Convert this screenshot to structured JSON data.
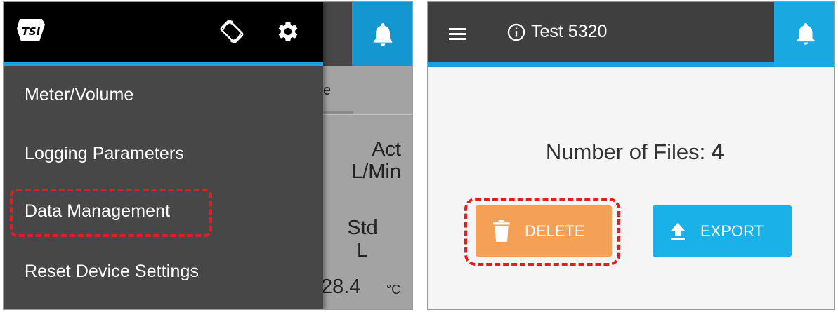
{
  "left_screen": {
    "header": {
      "logo_icon": "tsi-logo",
      "rotate_icon": "screen-rotation-icon",
      "settings_icon": "gear-icon",
      "notification_icon": "bell-icon"
    },
    "drawer": {
      "items": [
        {
          "label": "Meter/Volume"
        },
        {
          "label": "Logging Parameters"
        },
        {
          "label": "Data Management",
          "highlighted": true
        },
        {
          "label": "Reset Device Settings"
        }
      ]
    },
    "background": {
      "tab_partial": "e",
      "act_label": "Act",
      "act_unit": "L/Min",
      "std_label": "Std",
      "std_unit": "L",
      "temperature_value": "28.4",
      "temperature_unit": "°C"
    },
    "colors": {
      "drawer_bg": "#474747",
      "header_bg": "#000000",
      "accent": "#1aa0da",
      "highlight": "#e02020"
    }
  },
  "right_screen": {
    "header": {
      "menu_icon": "hamburger-icon",
      "info_icon": "info-icon",
      "title": "Test 5320",
      "notification_icon": "bell-icon"
    },
    "content": {
      "files_label": "Number of Files:",
      "files_count": "4"
    },
    "buttons": {
      "delete_label": "DELETE",
      "export_label": "EXPORT"
    },
    "colors": {
      "header_bg": "#3f3f3f",
      "accent": "#1aa0da",
      "delete_bg": "#f4a157",
      "export_bg": "#1ab0e8",
      "highlight": "#e02020"
    }
  }
}
